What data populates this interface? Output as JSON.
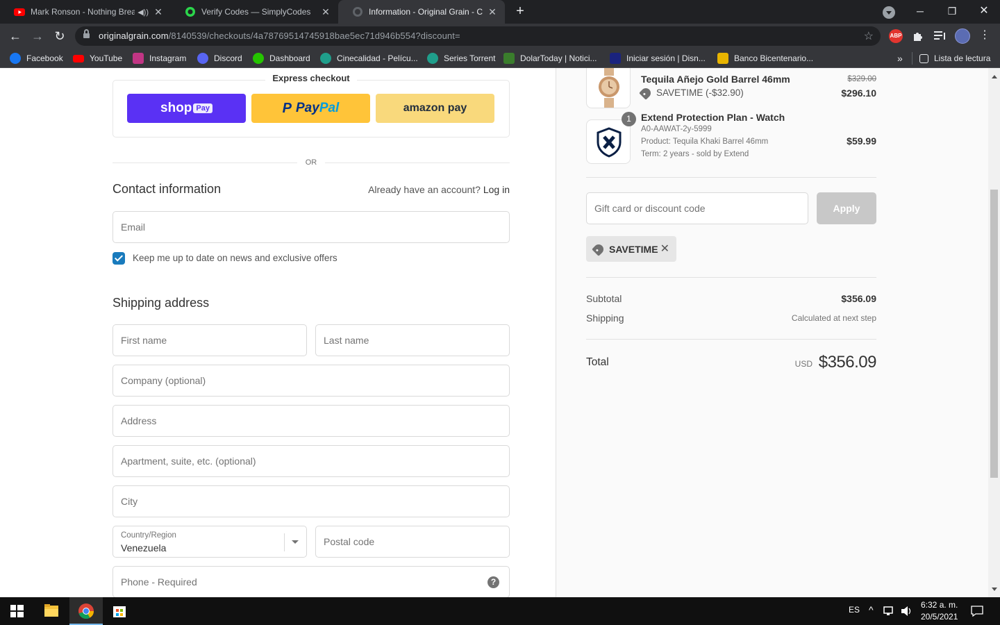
{
  "browser": {
    "tabs": [
      {
        "title": "Mark Ronson - Nothing Brea",
        "icon": "youtube-icon",
        "audio": true,
        "active": false
      },
      {
        "title": "Verify Codes — SimplyCodes",
        "icon": "simplycodes-icon",
        "active": false
      },
      {
        "title": "Information - Original Grain - Ch",
        "icon": "globe-icon",
        "active": true
      }
    ],
    "new_tab": "+",
    "url_host": "originalgrain.com",
    "url_path": "/8140539/checkouts/4a78769514745918bae5ec71d946b554?discount=",
    "extensions": [
      "ABP"
    ],
    "bookmarks": [
      {
        "label": "Facebook",
        "color": "#1877f2"
      },
      {
        "label": "YouTube",
        "color": "#ff0000"
      },
      {
        "label": "Instagram",
        "color": "#c13584"
      },
      {
        "label": "Discord",
        "color": "#5865f2"
      },
      {
        "label": "Dashboard",
        "color": "#25c400"
      },
      {
        "label": "Cinecalidad - Pelícu...",
        "color": "#1f9e8b"
      },
      {
        "label": "Series Torrent",
        "color": "#1f9e8b"
      },
      {
        "label": "DolarToday | Notici...",
        "color": "#3a7d2c"
      },
      {
        "label": "Iniciar sesión | Disn...",
        "color": "#1a237e"
      },
      {
        "label": "Banco Bicentenario...",
        "color": "#e8b400"
      }
    ],
    "reading_list": "Lista de lectura"
  },
  "checkout": {
    "express_title": "Express checkout",
    "shop_pay": {
      "shop": "shop",
      "pay": "Pay"
    },
    "paypal": {
      "p1": "Pay",
      "p2": "Pal"
    },
    "amazon_pay": "amazon pay",
    "or": "OR",
    "contact_title": "Contact information",
    "account_prompt": "Already have an account?",
    "login_link": "Log in",
    "email_placeholder": "Email",
    "newsletter_label": "Keep me up to date on news and exclusive offers",
    "shipping_title": "Shipping address",
    "placeholders": {
      "first_name": "First name",
      "last_name": "Last name",
      "company": "Company (optional)",
      "address": "Address",
      "apartment": "Apartment, suite, etc. (optional)",
      "city": "City",
      "postal_code": "Postal code",
      "phone": "Phone - Required"
    },
    "country_label": "Country/Region",
    "country_value": "Venezuela",
    "help": "?"
  },
  "summary": {
    "items": [
      {
        "name": "Tequila Añejo Gold Barrel 46mm",
        "discount": "SAVETIME (-$32.90)",
        "price_original": "$329.00",
        "price": "$296.10"
      },
      {
        "qty": "1",
        "name": "Extend Protection Plan - Watch",
        "sku": "A0-AAWAT-2y-5999",
        "product": "Product: Tequila Khaki Barrel 46mm",
        "term": "Term: 2 years - sold by Extend",
        "price": "$59.99"
      }
    ],
    "discount_placeholder": "Gift card or discount code",
    "apply_label": "Apply",
    "applied_code": "SAVETIME",
    "subtotal_label": "Subtotal",
    "subtotal_value": "$356.09",
    "shipping_label": "Shipping",
    "shipping_value": "Calculated at next step",
    "total_label": "Total",
    "currency": "USD",
    "total_value": "$356.09"
  },
  "taskbar": {
    "language": "ES",
    "time": "6:32 a. m.",
    "date": "20/5/2021"
  }
}
